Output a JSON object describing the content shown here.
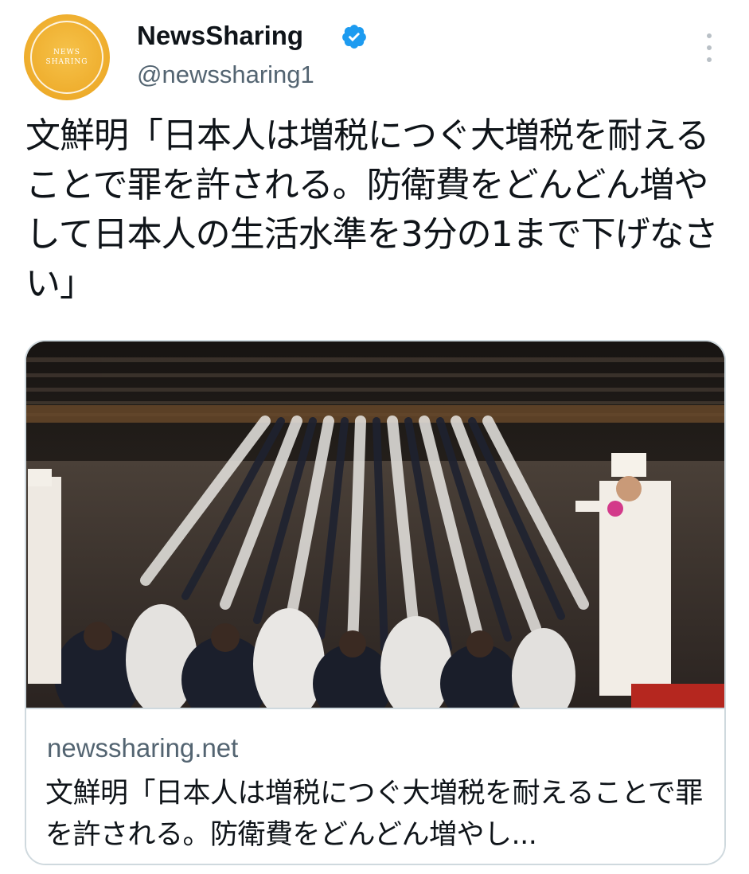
{
  "tweet": {
    "author": {
      "display_name": "NewsSharing",
      "handle": "@newssharing1",
      "avatar_text": "NEWS SHARING",
      "verified_icon": "verified-badge-icon",
      "avatar_color": "#eeac2b",
      "verified_color": "#1d9bf0"
    },
    "more_icon": "more-options-icon",
    "text": "文鮮明「日本人は増税につぐ大増税を耐えることで罪を許される。防衛費をどんどん増やして日本人の生活水準を3分の1まで下げなさい」",
    "card": {
      "image_description_icon": "photo-thumbnail",
      "domain": "newssharing.net",
      "title": "文鮮明「日本人は増税につぐ大増税を耐えることで罪を許される。防衛費をどんどん増やし..."
    }
  }
}
